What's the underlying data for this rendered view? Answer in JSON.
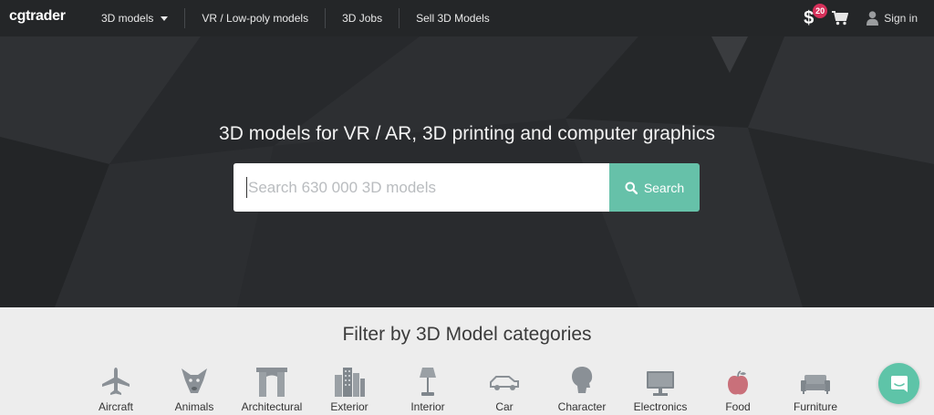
{
  "brand": {
    "logo_text": "cgtrader"
  },
  "nav": {
    "items": [
      {
        "label": "3D models",
        "has_dropdown": true
      },
      {
        "label": "VR / Low-poly models"
      },
      {
        "label": "3D Jobs"
      },
      {
        "label": "Sell 3D Models"
      }
    ],
    "currency_symbol": "$",
    "notification_count": "20",
    "cart_icon": "cart-icon",
    "signin_label": "Sign in"
  },
  "hero": {
    "title": "3D models for VR / AR, 3D printing and computer graphics",
    "search": {
      "value": "",
      "placeholder": "Search 630 000 3D models",
      "button_label": "Search"
    }
  },
  "categories": {
    "title": "Filter by 3D Model categories",
    "items": [
      {
        "label": "Aircraft",
        "icon": "aircraft-icon"
      },
      {
        "label": "Animals",
        "icon": "animals-icon"
      },
      {
        "label": "Architectural",
        "icon": "architectural-icon"
      },
      {
        "label": "Exterior",
        "icon": "exterior-icon"
      },
      {
        "label": "Interior",
        "icon": "interior-icon"
      },
      {
        "label": "Car",
        "icon": "car-icon"
      },
      {
        "label": "Character",
        "icon": "character-icon"
      },
      {
        "label": "Electronics",
        "icon": "electronics-icon"
      },
      {
        "label": "Food",
        "icon": "food-icon"
      },
      {
        "label": "Furniture",
        "icon": "furniture-icon"
      }
    ]
  },
  "colors": {
    "topbar": "#242628",
    "hero": "#2a2c2f",
    "accent": "#66c1a9",
    "badge": "#d6305a",
    "chat": "#5ec4a8"
  }
}
